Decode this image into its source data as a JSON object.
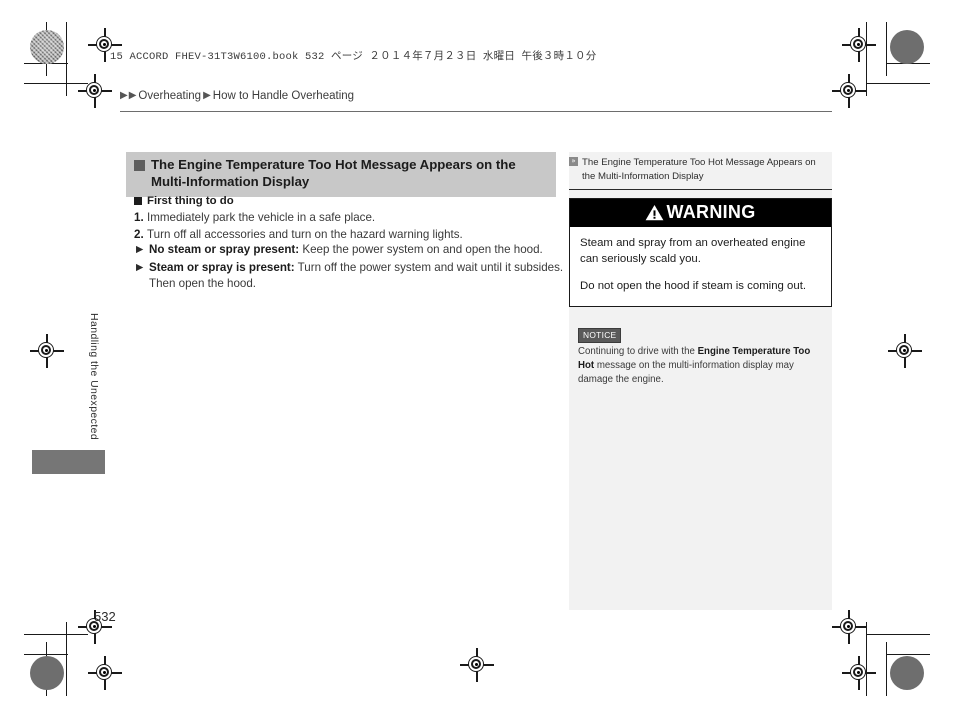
{
  "document": {
    "print_header": "15 ACCORD FHEV-31T3W6100.book    532 ページ    ２０１４年７月２３日    水曜日    午後３時１０分",
    "page_number": "532",
    "side_tab_label": "Handling the Unexpected"
  },
  "breadcrumb": {
    "arrow1": "▶",
    "arrow2": "▶",
    "level1": "Overheating",
    "arrow3": "▶",
    "level2": "How to Handle Overheating"
  },
  "main": {
    "section_title": "The Engine Temperature Too Hot Message Appears on the Multi-Information Display",
    "subsection_title": "First thing to do",
    "steps": [
      {
        "num": "1.",
        "text": "Immediately park the vehicle in a safe place."
      },
      {
        "num": "2.",
        "text": "Turn off all accessories and turn on the hazard warning lights."
      }
    ],
    "bullets": [
      {
        "marker": "▶",
        "bold": "No steam or spray present:",
        "text": " Keep the power system on and open the hood."
      },
      {
        "marker": "▶",
        "bold": "Steam or spray is present:",
        "text": " Turn off the power system and wait until it subsides. Then open the hood."
      }
    ]
  },
  "sidebar": {
    "marker_glyph": "»",
    "title": "The Engine Temperature Too Hot Message Appears on the Multi-Information Display",
    "warning": {
      "banner_label": "WARNING",
      "paragraph1": "Steam and spray from an overheated engine can seriously scald you.",
      "paragraph2": "Do not open the hood if steam is coming out."
    },
    "notice": {
      "label": "NOTICE",
      "text_before": "Continuing to drive with the ",
      "bold": "Engine Temperature Too Hot",
      "text_after": " message on the multi-information display may damage the engine."
    }
  },
  "colors": {
    "section_head_bg": "#c8c8c8",
    "sidebar_bg": "#f2f2f2",
    "warning_banner_bg": "#000000",
    "notice_label_bg": "#5a5a5a",
    "side_tab_bg": "#767676"
  }
}
